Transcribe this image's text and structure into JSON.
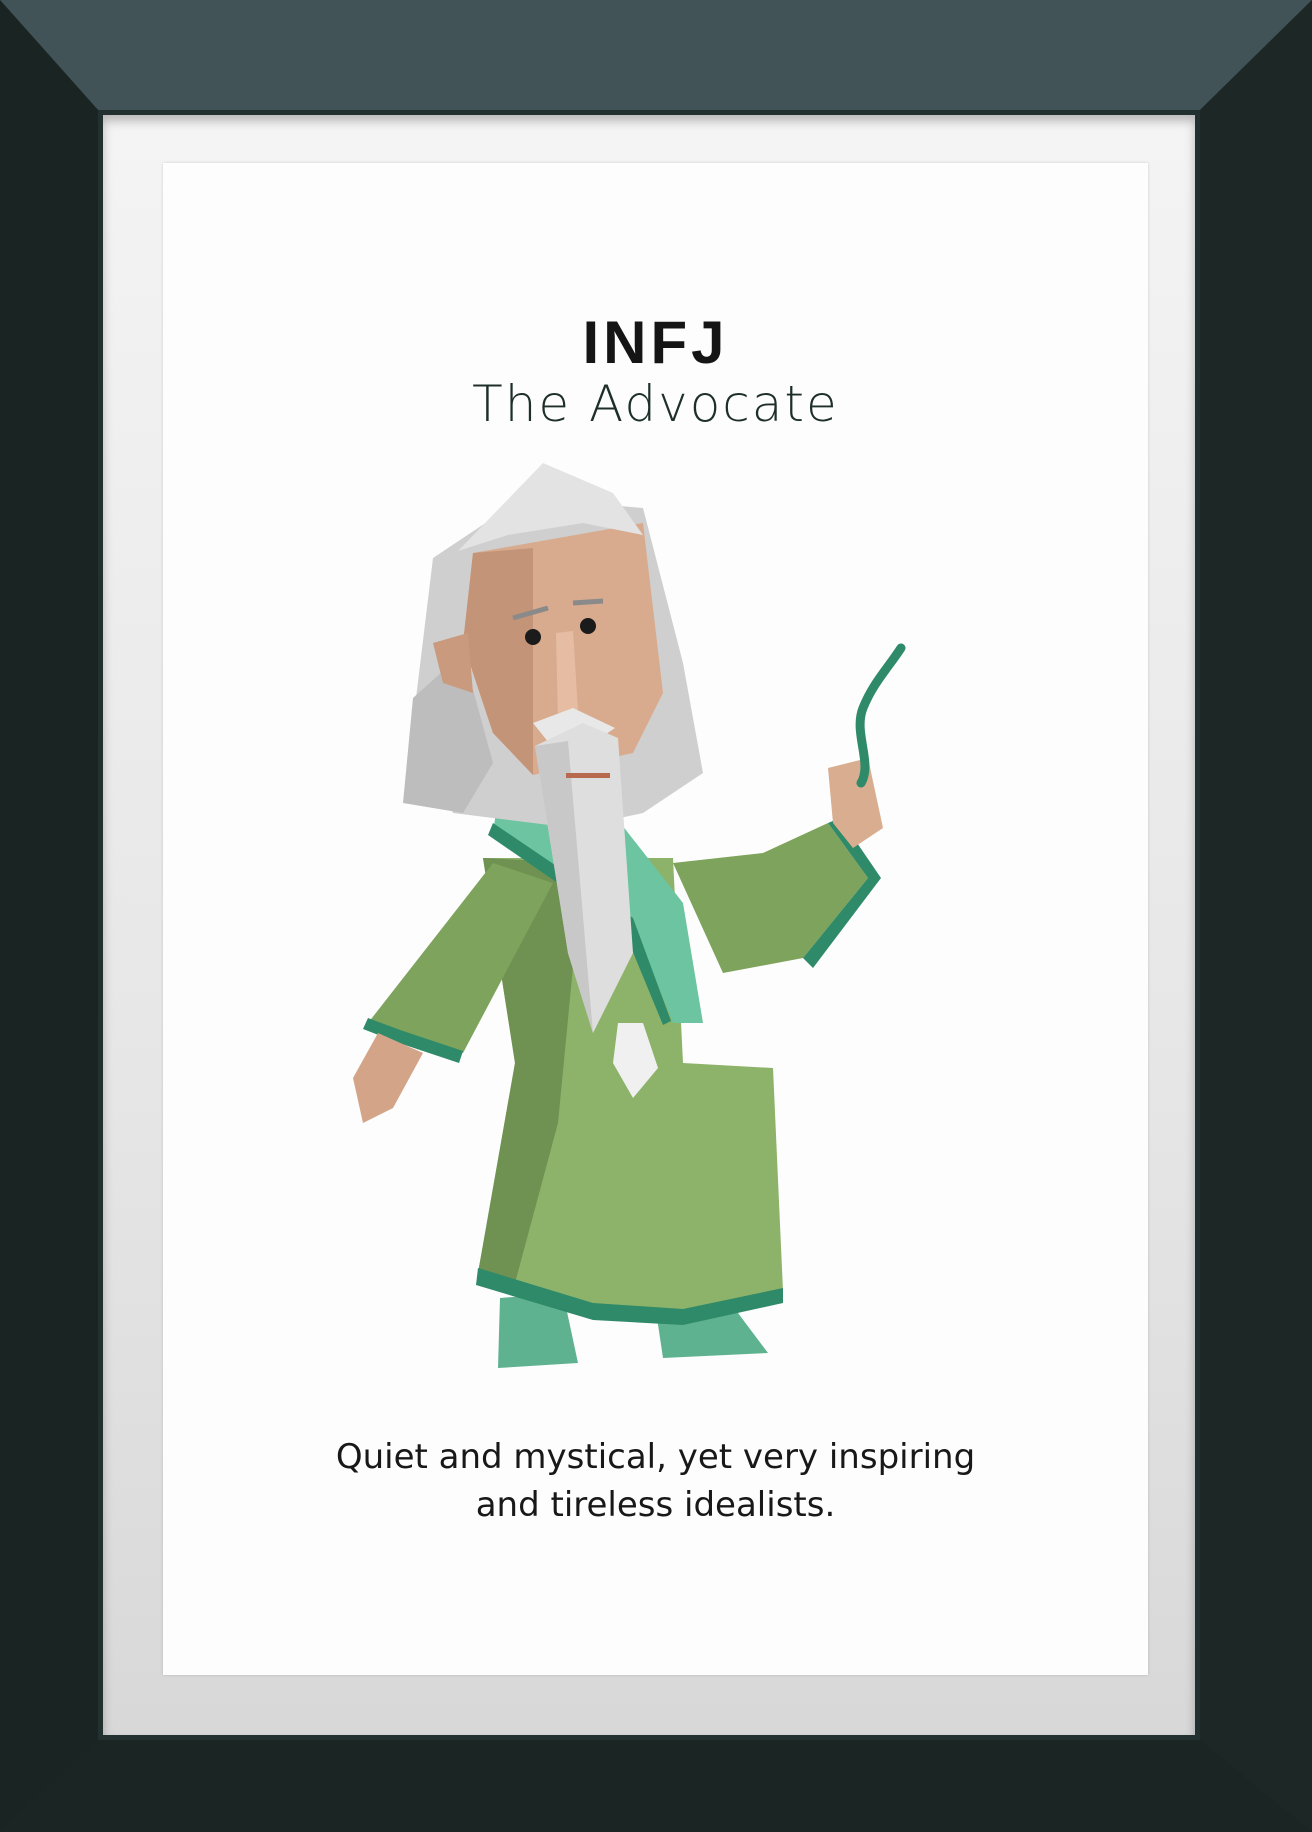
{
  "poster": {
    "type_code": "INFJ",
    "type_name": "The Advocate",
    "caption_line1": "Quiet and mystical, yet very inspiring",
    "caption_line2": "and tireless idealists."
  },
  "colors": {
    "frame": "#22302f",
    "robe": "#8db36a",
    "robe_dark": "#6f9152",
    "trim": "#2f8a6a",
    "sash": "#6cc4a0",
    "skin": "#d9a88a",
    "hair": "#dcdcdc"
  },
  "illustration": {
    "subject": "bearded-wizard-figure",
    "icon": "magic-wand-icon"
  }
}
